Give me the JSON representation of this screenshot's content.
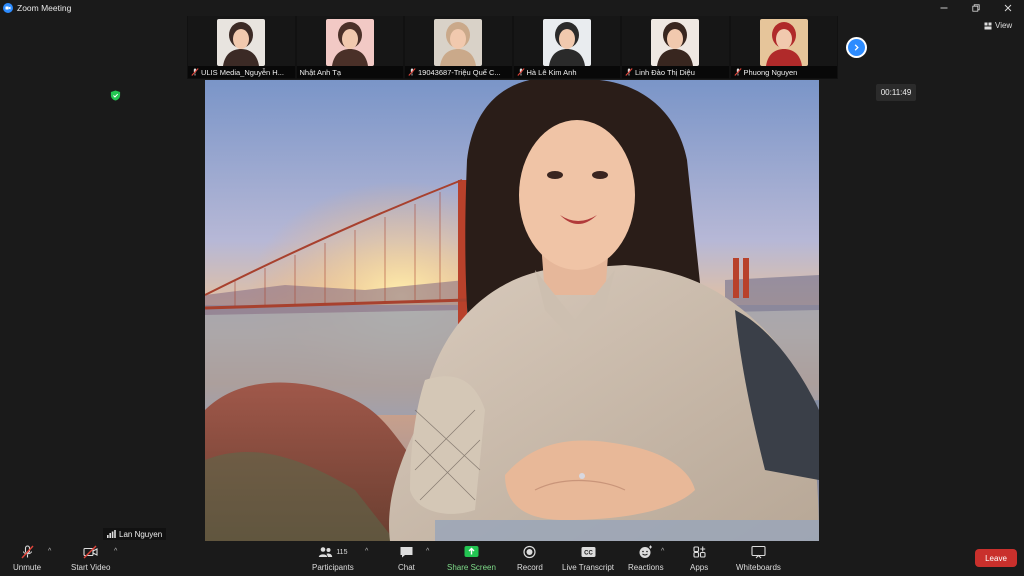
{
  "window": {
    "title": "Zoom Meeting"
  },
  "participants_strip": [
    {
      "name": "ULIS Media_Nguyễn H...",
      "muted": true,
      "bg": "#e8e4df",
      "face": "#3b2a25"
    },
    {
      "name": "Nhật Anh Tạ",
      "muted": false,
      "bg": "#f2c9c5",
      "face": "#4a3028"
    },
    {
      "name": "19043687-Triệu Quế C...",
      "muted": true,
      "bg": "#d9d2c8",
      "face": "#caa98a"
    },
    {
      "name": "Hà Lê Kim Anh",
      "muted": true,
      "bg": "#e9ecef",
      "face": "#2a2a2a"
    },
    {
      "name": "Linh Đào Thị Diệu",
      "muted": true,
      "bg": "#efe8e2",
      "face": "#38261f"
    },
    {
      "name": "Phuong Nguyen",
      "muted": true,
      "bg": "#e6c59a",
      "face": "#b02a2a"
    }
  ],
  "view_label": "View",
  "timer": "00:11:49",
  "active_speaker": "Lan Nguyen",
  "toolbar": {
    "unmute": "Unmute",
    "start_video": "Start Video",
    "participants": "Participants",
    "participants_count": "115",
    "chat": "Chat",
    "share_screen": "Share Screen",
    "record": "Record",
    "live_transcript": "Live Transcript",
    "reactions": "Reactions",
    "apps": "Apps",
    "whiteboards": "Whiteboards",
    "leave": "Leave"
  },
  "colors": {
    "accent": "#2d8cff",
    "leave": "#c9302c",
    "share": "#23c552",
    "muted_icon": "#e0443a"
  },
  "icons": {
    "mic": "mic-off-icon",
    "video": "video-off-icon",
    "participants": "people-icon",
    "chat": "chat-bubble-icon",
    "share": "share-arrow-icon",
    "record": "record-icon",
    "transcript": "cc-icon",
    "reactions": "smiley-plus-icon",
    "apps": "apps-icon",
    "whiteboards": "whiteboard-icon"
  }
}
